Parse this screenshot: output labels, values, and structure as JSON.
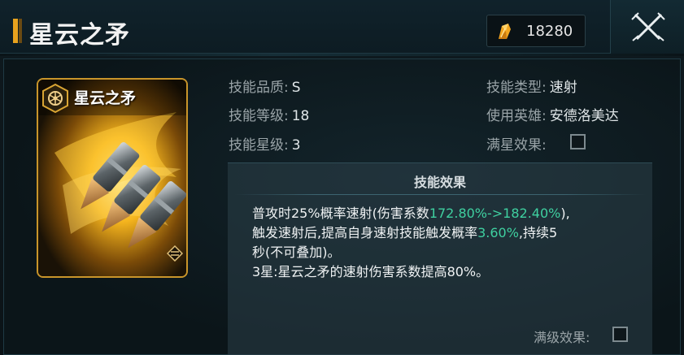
{
  "header": {
    "title": "星云之矛",
    "currency": {
      "icon": "crystal-shard-icon",
      "value": "18280"
    },
    "close_icon": "close-crossed-swords-icon"
  },
  "card": {
    "title": "星云之矛",
    "badge_icon": "hex-emblem-icon",
    "art_icon": "bullet-volley-icon",
    "corner_icon": "rank-chevron-icon",
    "border_color": "#c9952a"
  },
  "skill_info": {
    "quality_label": "技能品质:",
    "quality_value": "S",
    "level_label": "技能等级:",
    "level_value": "18",
    "star_label": "技能星级:",
    "star_value": "3",
    "type_label": "技能类型:",
    "type_value": "速射",
    "hero_label": "使用英雄:",
    "hero_value": "安德洛美达",
    "max_star_label": "满星效果:",
    "max_star_checked": false
  },
  "effect": {
    "title": "技能效果",
    "line1_a": "普攻时25%概率速射(伤害系数",
    "line1_hl": "172.80%->182.40%",
    "line1_b": "),",
    "line2_a": "触发速射后,提高自身速射技能触发概率",
    "line2_hl": "3.60%",
    "line2_b": ",持续5",
    "line3": "秒(不可叠加)。",
    "line4": "3星:星云之矛的速射伤害系数提高80%。",
    "max_level_label": "满级效果:",
    "max_level_checked": false,
    "highlight_color": "#3fd0a0"
  }
}
